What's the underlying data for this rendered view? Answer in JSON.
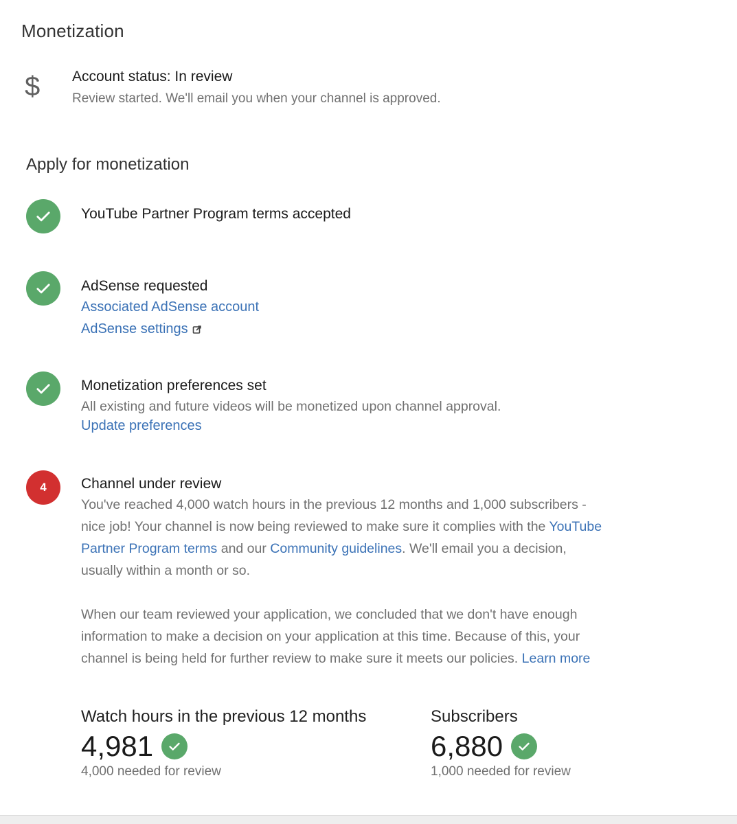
{
  "header": {
    "title": "Monetization"
  },
  "account_status": {
    "icon": "dollar-icon",
    "title": "Account status: In review",
    "subtitle": "Review started. We'll email you when your channel is approved."
  },
  "apply": {
    "title": "Apply for monetization",
    "steps": [
      {
        "state": "done",
        "title": "YouTube Partner Program terms accepted"
      },
      {
        "state": "done",
        "title": "AdSense requested",
        "links": [
          "Associated AdSense account",
          "AdSense settings"
        ]
      },
      {
        "state": "done",
        "title": "Monetization preferences set",
        "description": "All existing and future videos will be monetized upon channel approval.",
        "link": "Update preferences"
      },
      {
        "state": "pending",
        "number": "4",
        "title": "Channel under review",
        "para1_a": "You've reached 4,000 watch hours in the previous 12 months and 1,000 subscribers - nice job! Your channel is now being reviewed to make sure it complies with the ",
        "para1_link1": "YouTube Partner Program terms",
        "para1_b": " and our ",
        "para1_link2": "Community guidelines",
        "para1_c": ". We'll email you a decision, usually within a month or so.",
        "para2": "When our team reviewed your application, we concluded that we don't have enough information to make a decision on your application at this time. Because of this, your channel is being held for further review to make sure it meets our policies. ",
        "para2_link": "Learn more"
      }
    ]
  },
  "stats": {
    "watch_hours": {
      "label": "Watch hours in the previous 12 months",
      "value": "4,981",
      "needed": "4,000 needed for review"
    },
    "subscribers": {
      "label": "Subscribers",
      "value": "6,880",
      "needed": "1,000 needed for review"
    }
  },
  "colors": {
    "check_green": "#5aa86a",
    "alert_red": "#d23030",
    "link_blue": "#3b72b6"
  }
}
